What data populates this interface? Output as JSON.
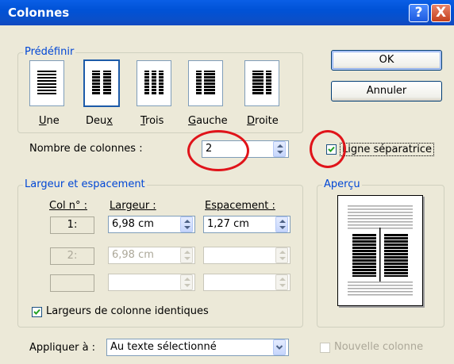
{
  "window": {
    "title": "Colonnes",
    "help_glyph": "?",
    "close_glyph": "X"
  },
  "buttons": {
    "ok": "OK",
    "cancel": "Annuler"
  },
  "predefinir": {
    "label": "Prédéfinir",
    "presets": [
      {
        "label_pre": "",
        "label_key": "U",
        "label_post": "ne",
        "name": "Une"
      },
      {
        "label_pre": "Deu",
        "label_key": "x",
        "label_post": "",
        "name": "Deux"
      },
      {
        "label_pre": "",
        "label_key": "T",
        "label_post": "rois",
        "name": "Trois"
      },
      {
        "label_pre": "",
        "label_key": "G",
        "label_post": "auche",
        "name": "Gauche"
      },
      {
        "label_pre": "",
        "label_key": "D",
        "label_post": "roite",
        "name": "Droite"
      }
    ],
    "selected": "Deux"
  },
  "nombre": {
    "label": "Nombre de colonnes :",
    "value": "2"
  },
  "ligne": {
    "label": "Ligne séparatrice",
    "checked": true
  },
  "largeur": {
    "label": "Largeur et espacement",
    "col_header": "Col n° :",
    "largeur_header": "Largeur :",
    "espacement_header": "Espacement :",
    "rows": [
      {
        "col": "1:",
        "largeur": "6,98 cm",
        "espacement": "1,27 cm",
        "enabled": true
      },
      {
        "col": "2:",
        "largeur": "6,98 cm",
        "espacement": "",
        "enabled": false
      },
      {
        "col": "",
        "largeur": "",
        "espacement": "",
        "enabled": false
      }
    ],
    "identiques_label": "Largeurs de colonne identiques",
    "identiques_checked": true
  },
  "apercu": {
    "label": "Aperçu"
  },
  "appliquer": {
    "label": "Appliquer à :",
    "value": "Au texte sélectionné"
  },
  "nouvelle_colonne": {
    "label": "Nouvelle colonne",
    "checked": false,
    "enabled": false
  },
  "colors": {
    "title_bar": "#0052D6",
    "group_label": "#0046D5",
    "dialog_bg": "#ECE9D8",
    "highlight_circle": "#E0141A"
  }
}
